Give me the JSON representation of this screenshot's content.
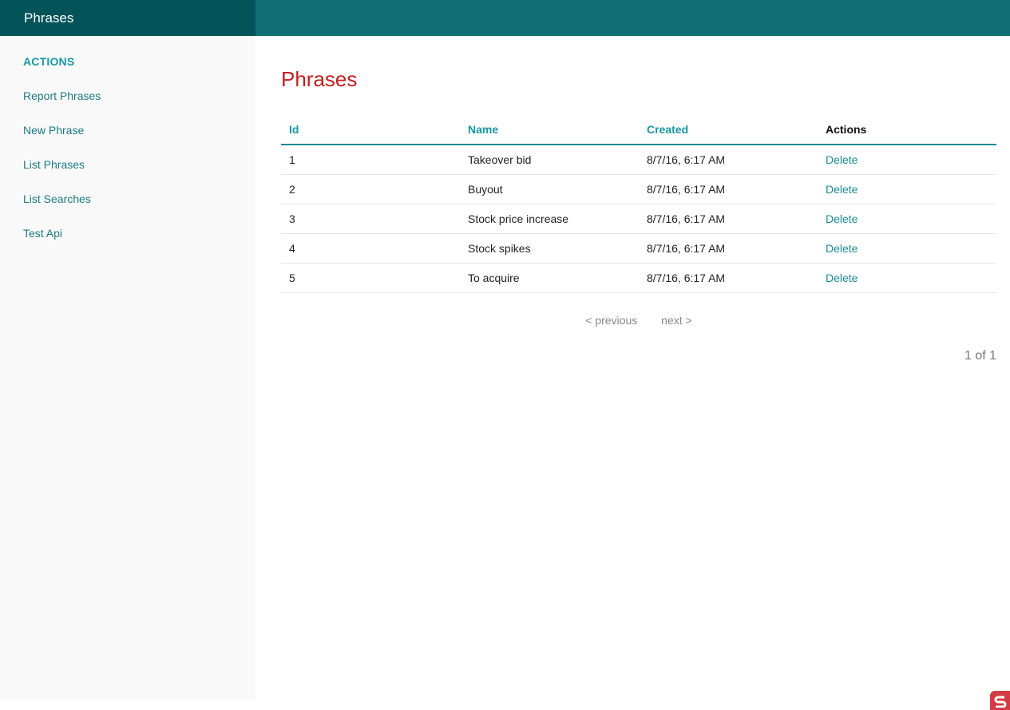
{
  "header": {
    "brand": "Phrases"
  },
  "sidebar": {
    "heading": "ACTIONS",
    "items": [
      {
        "label": "Report Phrases"
      },
      {
        "label": "New Phrase"
      },
      {
        "label": "List Phrases"
      },
      {
        "label": "List Searches"
      },
      {
        "label": "Test Api"
      }
    ]
  },
  "main": {
    "title": "Phrases",
    "table": {
      "columns": [
        "Id",
        "Name",
        "Created",
        "Actions"
      ],
      "rows": [
        {
          "id": "1",
          "name": "Takeover bid",
          "created": "8/7/16, 6:17 AM",
          "action": "Delete"
        },
        {
          "id": "2",
          "name": "Buyout",
          "created": "8/7/16, 6:17 AM",
          "action": "Delete"
        },
        {
          "id": "3",
          "name": "Stock price increase",
          "created": "8/7/16, 6:17 AM",
          "action": "Delete"
        },
        {
          "id": "4",
          "name": "Stock spikes",
          "created": "8/7/16, 6:17 AM",
          "action": "Delete"
        },
        {
          "id": "5",
          "name": "To acquire",
          "created": "8/7/16, 6:17 AM",
          "action": "Delete"
        }
      ]
    },
    "pagination": {
      "previous_label": "< previous",
      "next_label": "next >",
      "page_info": "1 of 1"
    }
  },
  "colors": {
    "topbar": "#116e74",
    "brand_bg": "#035459",
    "accent": "#1798a5",
    "title_red": "#c31f1f",
    "corner_logo": "#d33c44"
  },
  "icons": {
    "corner_logo": "debug-kit-logo-icon"
  }
}
